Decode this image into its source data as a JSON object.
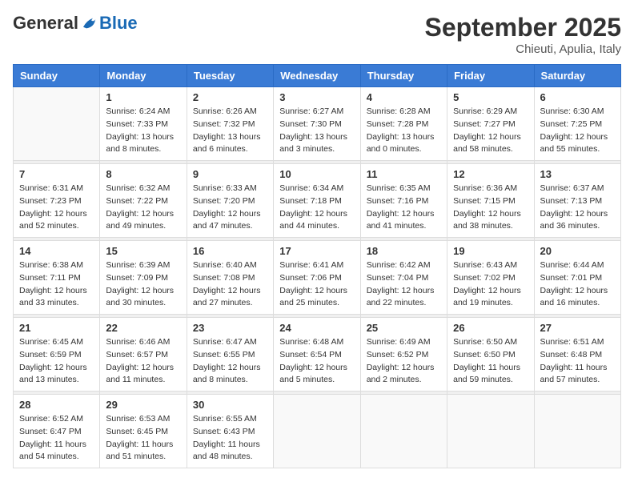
{
  "logo": {
    "general": "General",
    "blue": "Blue"
  },
  "title": "September 2025",
  "subtitle": "Chieuti, Apulia, Italy",
  "weekdays": [
    "Sunday",
    "Monday",
    "Tuesday",
    "Wednesday",
    "Thursday",
    "Friday",
    "Saturday"
  ],
  "weeks": [
    [
      {
        "day": "",
        "sunrise": "",
        "sunset": "",
        "daylight": ""
      },
      {
        "day": "1",
        "sunrise": "Sunrise: 6:24 AM",
        "sunset": "Sunset: 7:33 PM",
        "daylight": "Daylight: 13 hours and 8 minutes."
      },
      {
        "day": "2",
        "sunrise": "Sunrise: 6:26 AM",
        "sunset": "Sunset: 7:32 PM",
        "daylight": "Daylight: 13 hours and 6 minutes."
      },
      {
        "day": "3",
        "sunrise": "Sunrise: 6:27 AM",
        "sunset": "Sunset: 7:30 PM",
        "daylight": "Daylight: 13 hours and 3 minutes."
      },
      {
        "day": "4",
        "sunrise": "Sunrise: 6:28 AM",
        "sunset": "Sunset: 7:28 PM",
        "daylight": "Daylight: 13 hours and 0 minutes."
      },
      {
        "day": "5",
        "sunrise": "Sunrise: 6:29 AM",
        "sunset": "Sunset: 7:27 PM",
        "daylight": "Daylight: 12 hours and 58 minutes."
      },
      {
        "day": "6",
        "sunrise": "Sunrise: 6:30 AM",
        "sunset": "Sunset: 7:25 PM",
        "daylight": "Daylight: 12 hours and 55 minutes."
      }
    ],
    [
      {
        "day": "7",
        "sunrise": "Sunrise: 6:31 AM",
        "sunset": "Sunset: 7:23 PM",
        "daylight": "Daylight: 12 hours and 52 minutes."
      },
      {
        "day": "8",
        "sunrise": "Sunrise: 6:32 AM",
        "sunset": "Sunset: 7:22 PM",
        "daylight": "Daylight: 12 hours and 49 minutes."
      },
      {
        "day": "9",
        "sunrise": "Sunrise: 6:33 AM",
        "sunset": "Sunset: 7:20 PM",
        "daylight": "Daylight: 12 hours and 47 minutes."
      },
      {
        "day": "10",
        "sunrise": "Sunrise: 6:34 AM",
        "sunset": "Sunset: 7:18 PM",
        "daylight": "Daylight: 12 hours and 44 minutes."
      },
      {
        "day": "11",
        "sunrise": "Sunrise: 6:35 AM",
        "sunset": "Sunset: 7:16 PM",
        "daylight": "Daylight: 12 hours and 41 minutes."
      },
      {
        "day": "12",
        "sunrise": "Sunrise: 6:36 AM",
        "sunset": "Sunset: 7:15 PM",
        "daylight": "Daylight: 12 hours and 38 minutes."
      },
      {
        "day": "13",
        "sunrise": "Sunrise: 6:37 AM",
        "sunset": "Sunset: 7:13 PM",
        "daylight": "Daylight: 12 hours and 36 minutes."
      }
    ],
    [
      {
        "day": "14",
        "sunrise": "Sunrise: 6:38 AM",
        "sunset": "Sunset: 7:11 PM",
        "daylight": "Daylight: 12 hours and 33 minutes."
      },
      {
        "day": "15",
        "sunrise": "Sunrise: 6:39 AM",
        "sunset": "Sunset: 7:09 PM",
        "daylight": "Daylight: 12 hours and 30 minutes."
      },
      {
        "day": "16",
        "sunrise": "Sunrise: 6:40 AM",
        "sunset": "Sunset: 7:08 PM",
        "daylight": "Daylight: 12 hours and 27 minutes."
      },
      {
        "day": "17",
        "sunrise": "Sunrise: 6:41 AM",
        "sunset": "Sunset: 7:06 PM",
        "daylight": "Daylight: 12 hours and 25 minutes."
      },
      {
        "day": "18",
        "sunrise": "Sunrise: 6:42 AM",
        "sunset": "Sunset: 7:04 PM",
        "daylight": "Daylight: 12 hours and 22 minutes."
      },
      {
        "day": "19",
        "sunrise": "Sunrise: 6:43 AM",
        "sunset": "Sunset: 7:02 PM",
        "daylight": "Daylight: 12 hours and 19 minutes."
      },
      {
        "day": "20",
        "sunrise": "Sunrise: 6:44 AM",
        "sunset": "Sunset: 7:01 PM",
        "daylight": "Daylight: 12 hours and 16 minutes."
      }
    ],
    [
      {
        "day": "21",
        "sunrise": "Sunrise: 6:45 AM",
        "sunset": "Sunset: 6:59 PM",
        "daylight": "Daylight: 12 hours and 13 minutes."
      },
      {
        "day": "22",
        "sunrise": "Sunrise: 6:46 AM",
        "sunset": "Sunset: 6:57 PM",
        "daylight": "Daylight: 12 hours and 11 minutes."
      },
      {
        "day": "23",
        "sunrise": "Sunrise: 6:47 AM",
        "sunset": "Sunset: 6:55 PM",
        "daylight": "Daylight: 12 hours and 8 minutes."
      },
      {
        "day": "24",
        "sunrise": "Sunrise: 6:48 AM",
        "sunset": "Sunset: 6:54 PM",
        "daylight": "Daylight: 12 hours and 5 minutes."
      },
      {
        "day": "25",
        "sunrise": "Sunrise: 6:49 AM",
        "sunset": "Sunset: 6:52 PM",
        "daylight": "Daylight: 12 hours and 2 minutes."
      },
      {
        "day": "26",
        "sunrise": "Sunrise: 6:50 AM",
        "sunset": "Sunset: 6:50 PM",
        "daylight": "Daylight: 11 hours and 59 minutes."
      },
      {
        "day": "27",
        "sunrise": "Sunrise: 6:51 AM",
        "sunset": "Sunset: 6:48 PM",
        "daylight": "Daylight: 11 hours and 57 minutes."
      }
    ],
    [
      {
        "day": "28",
        "sunrise": "Sunrise: 6:52 AM",
        "sunset": "Sunset: 6:47 PM",
        "daylight": "Daylight: 11 hours and 54 minutes."
      },
      {
        "day": "29",
        "sunrise": "Sunrise: 6:53 AM",
        "sunset": "Sunset: 6:45 PM",
        "daylight": "Daylight: 11 hours and 51 minutes."
      },
      {
        "day": "30",
        "sunrise": "Sunrise: 6:55 AM",
        "sunset": "Sunset: 6:43 PM",
        "daylight": "Daylight: 11 hours and 48 minutes."
      },
      {
        "day": "",
        "sunrise": "",
        "sunset": "",
        "daylight": ""
      },
      {
        "day": "",
        "sunrise": "",
        "sunset": "",
        "daylight": ""
      },
      {
        "day": "",
        "sunrise": "",
        "sunset": "",
        "daylight": ""
      },
      {
        "day": "",
        "sunrise": "",
        "sunset": "",
        "daylight": ""
      }
    ]
  ]
}
